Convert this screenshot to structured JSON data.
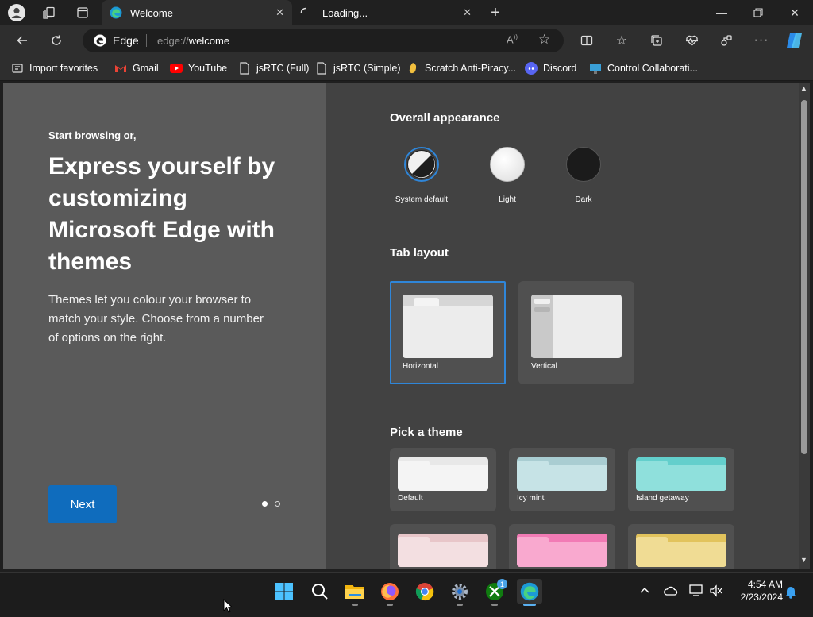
{
  "tabs": [
    {
      "label": "Welcome",
      "active": true
    },
    {
      "label": "Loading...",
      "active": false
    }
  ],
  "address": {
    "site_label": "Edge",
    "url_prefix": "edge://",
    "url_path": "welcome"
  },
  "favorites": [
    {
      "label": "Import favorites",
      "icon": "import-icon"
    },
    {
      "label": "Gmail",
      "icon": "gmail-icon"
    },
    {
      "label": "YouTube",
      "icon": "youtube-icon"
    },
    {
      "label": "jsRTC (Full)",
      "icon": "page-icon"
    },
    {
      "label": "jsRTC (Simple)",
      "icon": "page-icon"
    },
    {
      "label": "Scratch Anti-Piracy...",
      "icon": "scratch-icon"
    },
    {
      "label": "Discord",
      "icon": "discord-icon"
    },
    {
      "label": "Control Collaborati...",
      "icon": "monitor-icon"
    }
  ],
  "left": {
    "eyebrow": "Start browsing or,",
    "heading_lines": [
      "Express yourself by",
      "customizing",
      "Microsoft Edge with",
      "themes"
    ],
    "body_lines": [
      "Themes let you colour your browser to",
      "match your style. Choose from a number",
      "of options on the right."
    ],
    "next_label": "Next"
  },
  "appearance": {
    "title": "Overall appearance",
    "options": [
      {
        "label": "System default",
        "selected": true
      },
      {
        "label": "Light",
        "selected": false
      },
      {
        "label": "Dark",
        "selected": false
      }
    ]
  },
  "tab_layout": {
    "title": "Tab layout",
    "options": [
      {
        "label": "Horizontal",
        "selected": true
      },
      {
        "label": "Vertical",
        "selected": false
      }
    ]
  },
  "themes": {
    "title": "Pick a theme",
    "items": [
      {
        "label": "Default",
        "color": "#e8e8e8",
        "tab": "#f4f4f4"
      },
      {
        "label": "Icy mint",
        "color": "#a9cdd2",
        "tab": "#c6e3e6"
      },
      {
        "label": "Island getaway",
        "color": "#63cfcc",
        "tab": "#8fe0dc"
      },
      {
        "label": "",
        "color": "#e8c6c9",
        "tab": "#f3dfe1"
      },
      {
        "label": "",
        "color": "#f27bb5",
        "tab": "#f9a9cf"
      },
      {
        "label": "",
        "color": "#e2c35c",
        "tab": "#f0dc94"
      }
    ]
  },
  "clock": {
    "time": "4:54 AM",
    "date": "2/23/2024"
  },
  "colors": {
    "accent": "#0f6cbd",
    "selected_border": "#2f86d9"
  }
}
